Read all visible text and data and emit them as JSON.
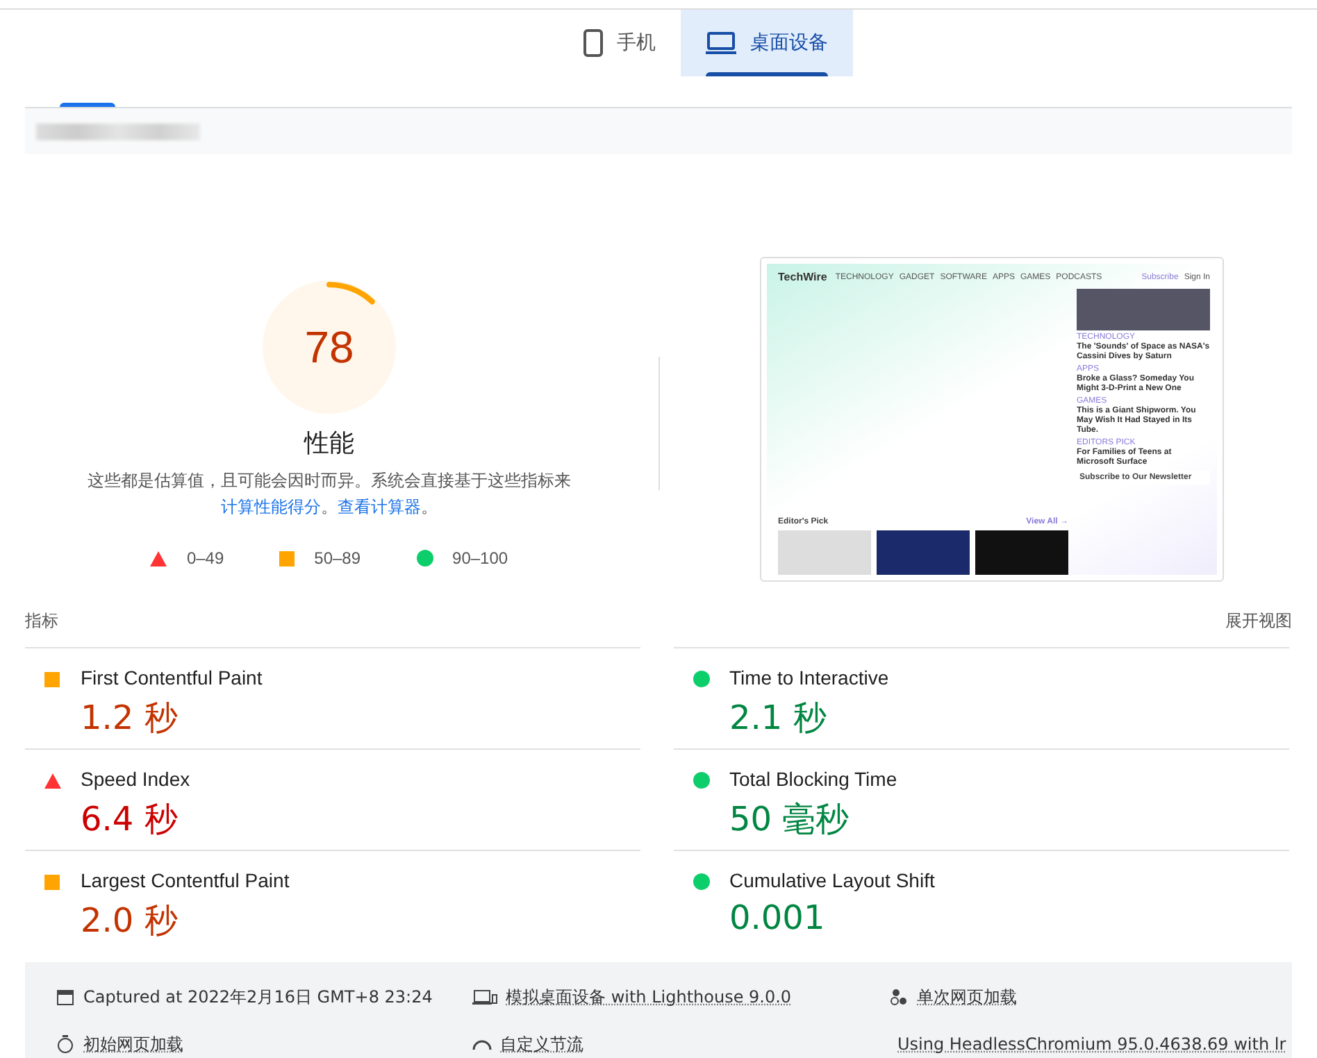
{
  "device_tabs": [
    {
      "label": "手机",
      "kind": "phone",
      "selected": false
    },
    {
      "label": "桌面设备",
      "kind": "desktop",
      "selected": true
    }
  ],
  "gauge": {
    "score": "78",
    "level": 0.12,
    "title": "性能",
    "kind": "average"
  },
  "description": {
    "text": "这些都是估算值，且可能会因时而异。系统会直接基于这些指标来",
    "link1": "计算性能得分",
    "sep": "。",
    "link2": "查看计算器",
    "end": "。"
  },
  "legend": [
    {
      "kind": "fail",
      "range": "0–49"
    },
    {
      "kind": "average",
      "range": "50–89"
    },
    {
      "kind": "pass",
      "range": "90–100"
    }
  ],
  "preview": {
    "logo": "TechWire",
    "nav": [
      "TECHNOLOGY",
      "GADGET",
      "SOFTWARE",
      "APPS",
      "GAMES",
      "PODCASTS"
    ],
    "subscribe": "Subscribe",
    "sign_in": "Sign In",
    "articles": [
      {
        "category": "TECHNOLOGY",
        "title": "The 'Sounds' of Space as NASA's Cassini Dives by Saturn"
      },
      {
        "category": "APPS",
        "title": "Broke a Glass? Someday You Might 3-D-Print a New One"
      },
      {
        "category": "GAMES",
        "title": "This is a Giant Shipworm. You May Wish It Had Stayed in Its Tube."
      },
      {
        "category": "EDITORS PICK",
        "title": "For Families of Teens at Microsoft Surface"
      }
    ],
    "editors_pick": "Editor's Pick",
    "view_all": "View All →",
    "newsletter": "Subscribe to Our Newsletter"
  },
  "metrics_header": {
    "title": "指标",
    "toggle": "展开视图"
  },
  "metrics": [
    {
      "label": "First Contentful Paint",
      "value": "1.2 秒",
      "kind": "average"
    },
    {
      "label": "Time to Interactive",
      "value": "2.1 秒",
      "kind": "pass"
    },
    {
      "label": "Speed Index",
      "value": "6.4 秒",
      "kind": "fail"
    },
    {
      "label": "Total Blocking Time",
      "value": "50 毫秒",
      "kind": "pass"
    },
    {
      "label": "Largest Contentful Paint",
      "value": "2.0 秒",
      "kind": "average"
    },
    {
      "label": "Cumulative Layout Shift",
      "value": "0.001",
      "kind": "pass"
    }
  ],
  "footer": [
    {
      "kind": "calendar",
      "text": "Captured at 2022年2月16日 GMT+8 23:24",
      "underlined": false
    },
    {
      "kind": "device",
      "text": "模拟桌面设备 with Lighthouse 9.0.0",
      "underlined": true
    },
    {
      "kind": "dots",
      "text": "单次网页加载",
      "underlined": true
    },
    {
      "kind": "timer",
      "text": "初始网页加载",
      "underlined": true
    },
    {
      "kind": "throttle",
      "text": "自定义节流",
      "underlined": true
    },
    {
      "kind": "chrome",
      "text": "Using HeadlessChromium 95.0.4638.69 with lr",
      "underlined": true
    }
  ]
}
